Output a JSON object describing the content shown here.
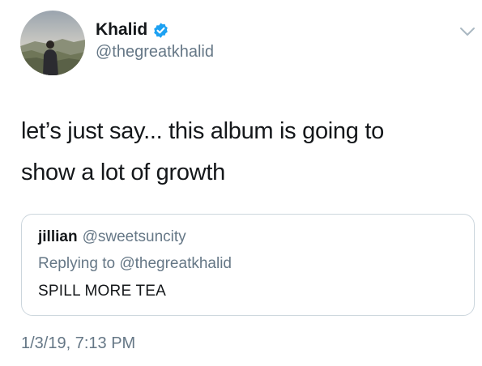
{
  "tweet": {
    "author": {
      "display_name": "Khalid",
      "handle": "@thegreatkhalid",
      "verified": true,
      "avatar": "profile-photo"
    },
    "text_line_1": "let’s just say... this album is going to",
    "text_line_2": "show a lot of growth",
    "timestamp": "1/3/19, 7:13 PM",
    "menu_icon": "chevron-down-icon"
  },
  "quoted_tweet": {
    "display_name": "jillian",
    "handle": "@sweetsuncity",
    "replying_to": "Replying to @thegreatkhalid",
    "text": "SPILL MORE TEA"
  },
  "colors": {
    "text_primary": "#14171a",
    "text_secondary": "#657786",
    "verified_blue": "#1da1f2",
    "border": "#ccd6dd"
  }
}
